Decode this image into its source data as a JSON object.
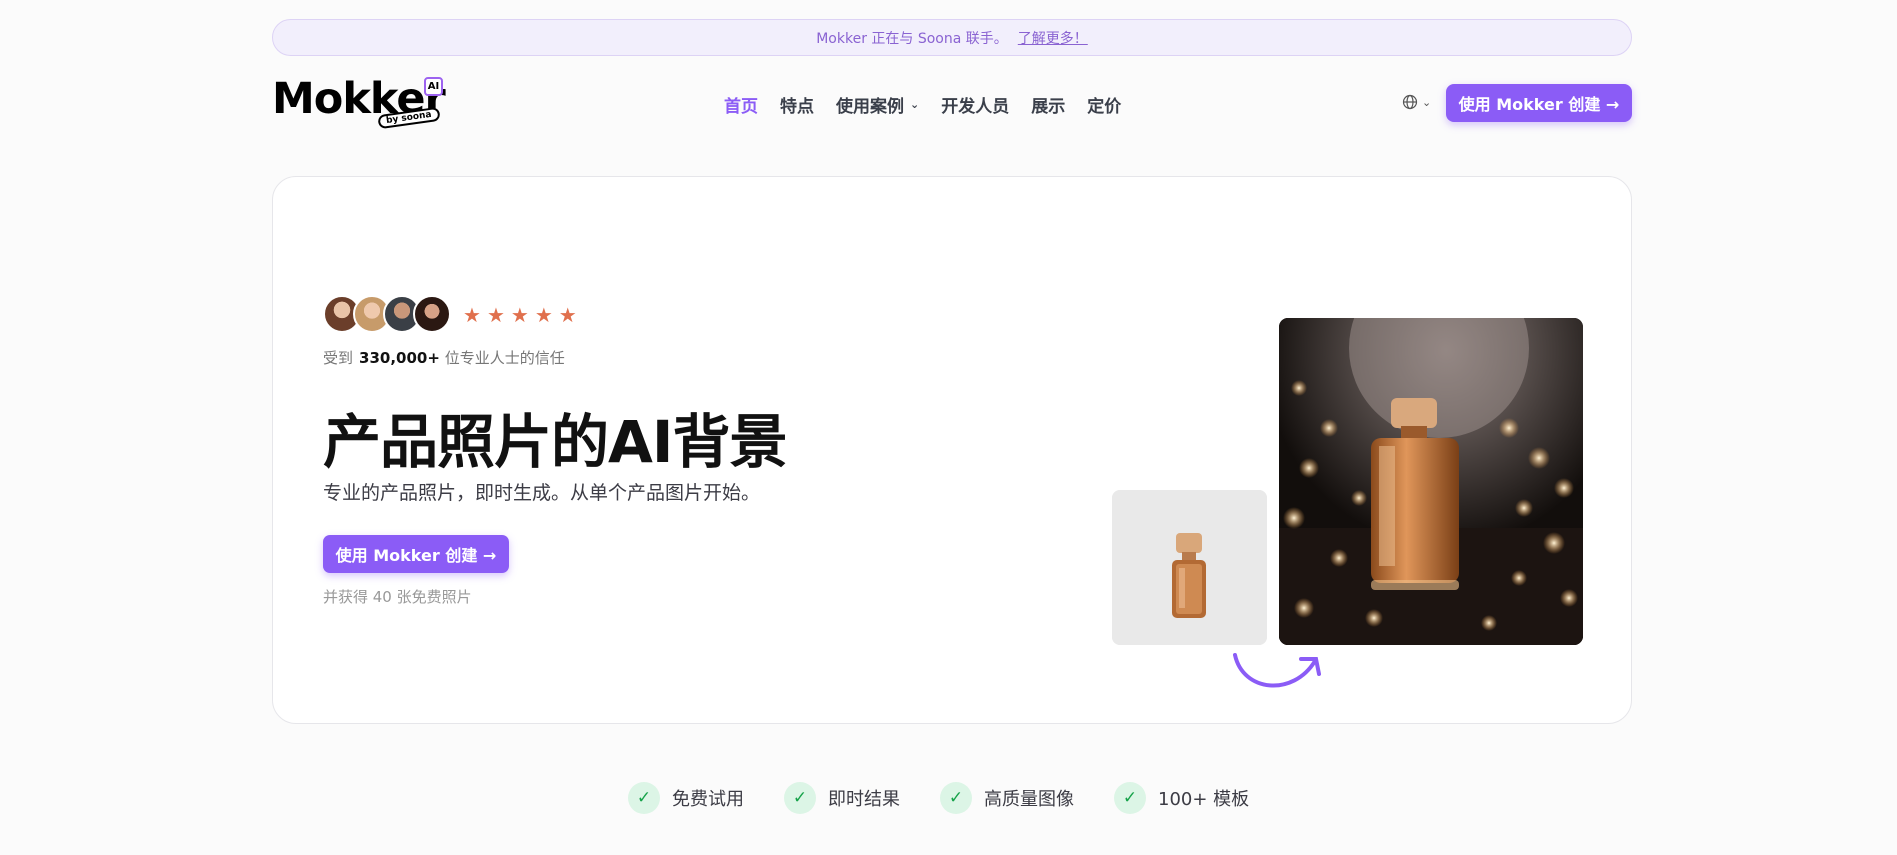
{
  "banner": {
    "text": "Mokker 正在与 Soona 联手。",
    "link": "了解更多！"
  },
  "logo": {
    "wordmark": "Mokker",
    "ai_badge": "AI",
    "by_soona": "by soona"
  },
  "nav": {
    "items": [
      "首页",
      "特点",
      "使用案例",
      "开发人员",
      "展示",
      "定价"
    ]
  },
  "header_cta": "使用 Mokker 创建 →",
  "hero": {
    "rating_stars": 5,
    "trust_prefix": "受到",
    "trust_count": "330,000+",
    "trust_suffix": "位专业人士的信任",
    "title": "产品照片的AI背景",
    "subtitle": "专业的产品照片，即时生成。从单个产品图片开始。",
    "cta": "使用 Mokker 创建 →",
    "note": "并获得 40 张免费照片"
  },
  "features": [
    "免费试用",
    "即时结果",
    "高质量图像",
    "100+ 模板"
  ],
  "colors": {
    "accent": "#8b5cf6",
    "star": "#e0704d",
    "check": "#16a34a"
  }
}
